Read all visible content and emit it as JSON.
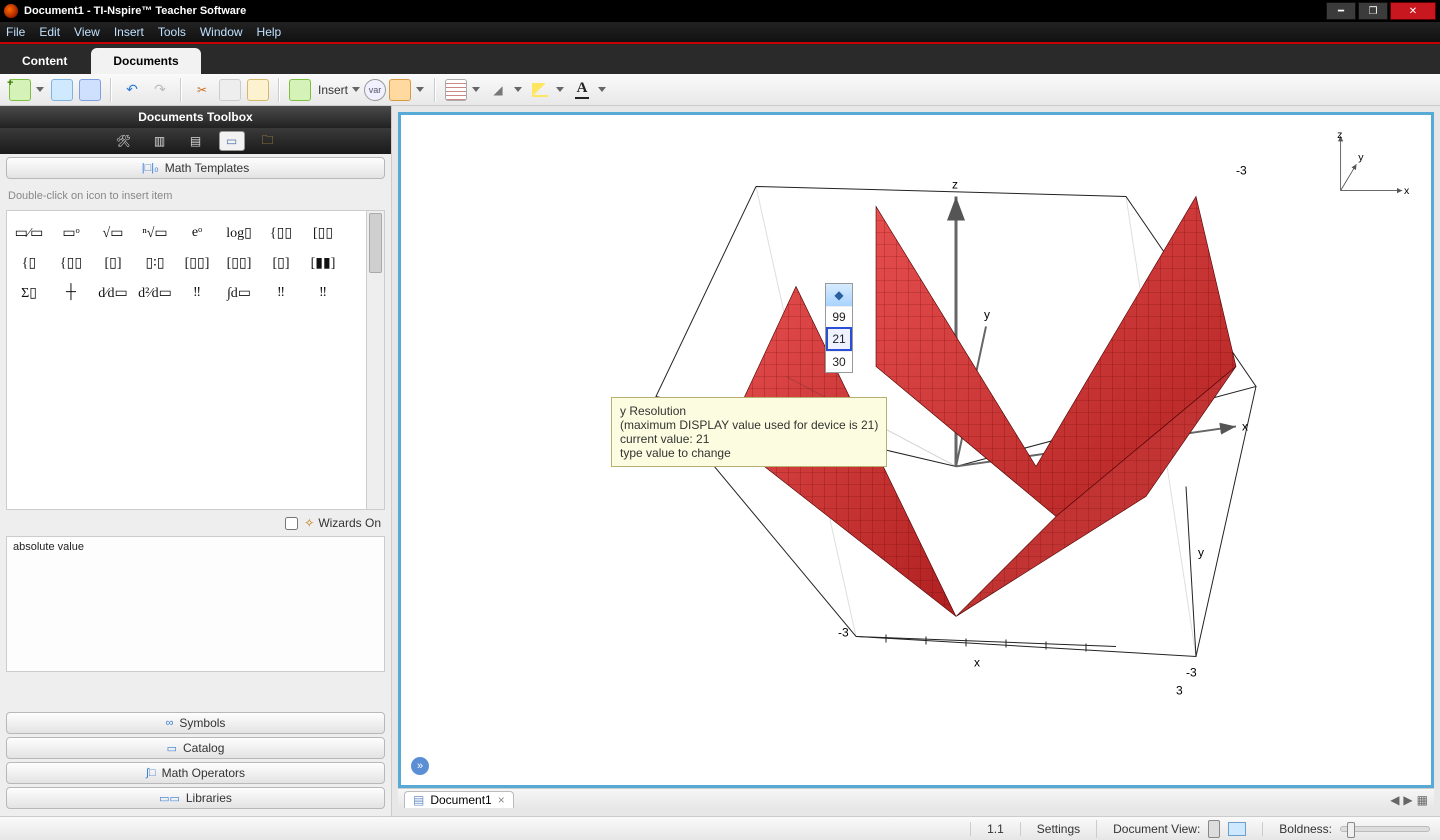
{
  "titlebar": {
    "title": "Document1 - TI-Nspire™ Teacher Software"
  },
  "menu": [
    "File",
    "Edit",
    "View",
    "Insert",
    "Tools",
    "Window",
    "Help"
  ],
  "workspace_tabs": {
    "content": "Content",
    "documents": "Documents"
  },
  "toolbar": {
    "insert": "Insert",
    "var": "var"
  },
  "toolbox": {
    "header": "Documents Toolbox",
    "math_templates": "Math Templates",
    "hint": "Double-click on icon to insert item",
    "wizards": "Wizards On",
    "search_value": "absolute value",
    "sections": {
      "symbols": "Symbols",
      "catalog": "Catalog",
      "mathops": "Math Operators",
      "libraries": "Libraries"
    }
  },
  "templates_glyphs": [
    "▭⁄▭",
    "▭ᵒ",
    "√▭",
    "ⁿ√▭",
    "eᵒ",
    "log▯",
    "{▯▯",
    "[▯▯",
    "{▯",
    "{▯▯",
    "[▯]",
    "▯∶▯",
    "[▯▯]",
    "[▯▯]",
    "[▯]",
    "[▮▮]",
    "Σ▯",
    "┼",
    "d⁄d▭",
    "d²⁄d▭",
    "‼",
    "∫d▭",
    "‼",
    "‼"
  ],
  "canvas": {
    "axis_labels": {
      "x": "x",
      "y": "y",
      "z": "z"
    },
    "bound_neg": "-3",
    "bound_pos": "3",
    "popup": {
      "v1": "99",
      "v2": "21",
      "v3": "30"
    },
    "tooltip": {
      "l1": "y Resolution",
      "l2": "(maximum DISPLAY value used for device is 21)",
      "l3": "current value: 21",
      "l4": "type value to change"
    }
  },
  "doctab": {
    "name": "Document1"
  },
  "status": {
    "page": "1.1",
    "settings": "Settings",
    "docview": "Document View:",
    "boldness": "Boldness:"
  }
}
